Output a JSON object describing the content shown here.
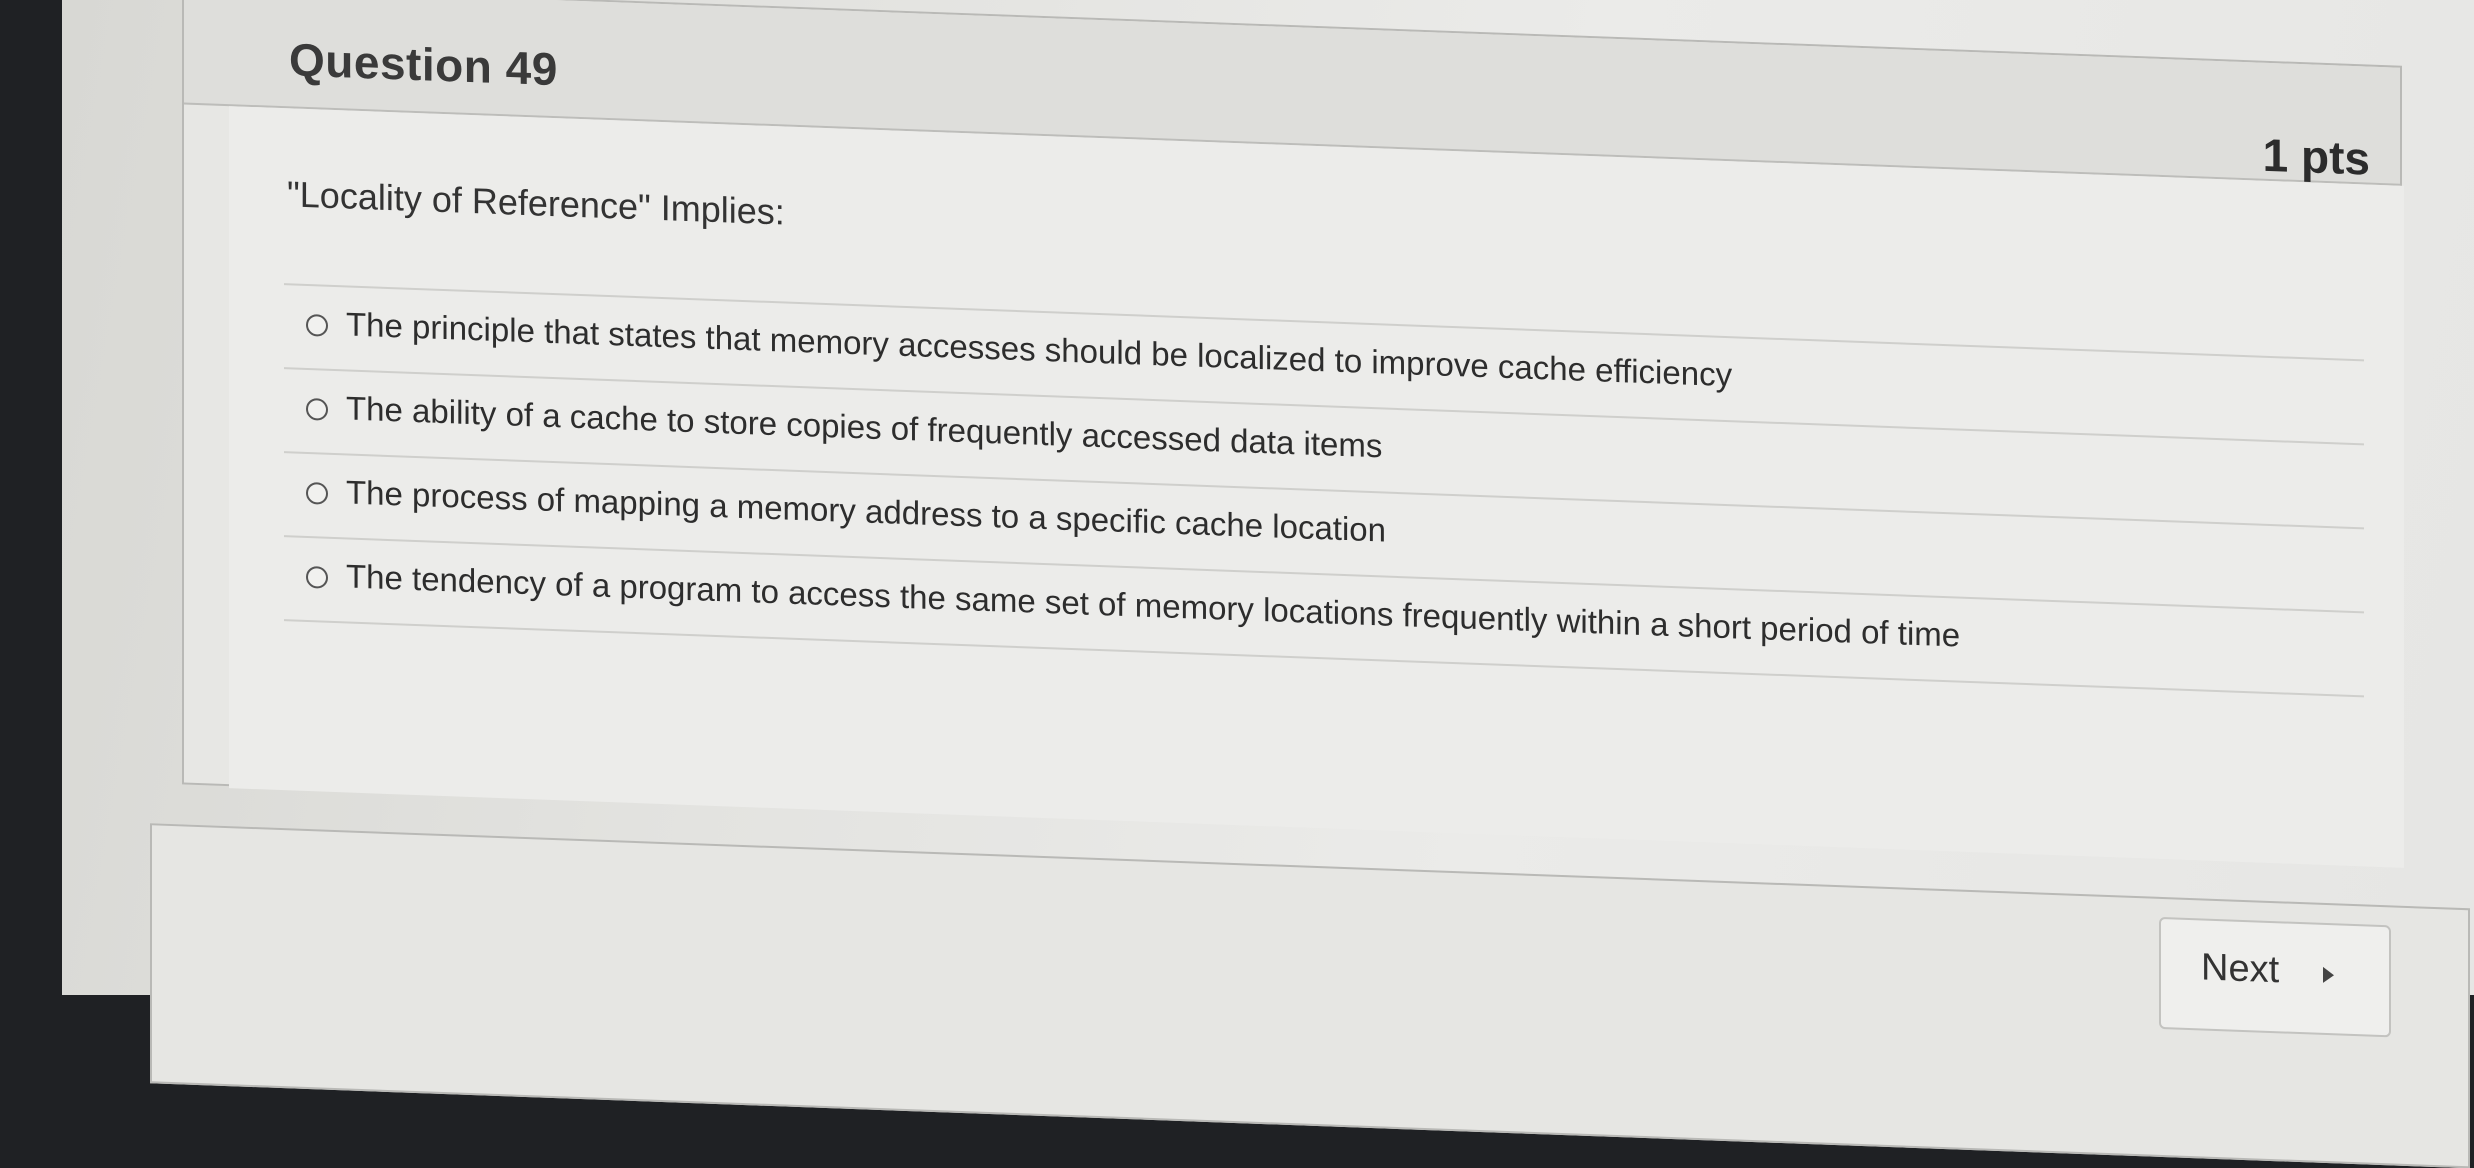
{
  "question": {
    "title": "Question 49",
    "points": "1 pts",
    "prompt": "\"Locality of Reference\" Implies:",
    "answers": [
      {
        "label": "The principle that states that memory accesses should be localized to improve cache efficiency"
      },
      {
        "label": "The ability of a cache to store copies of frequently accessed data items"
      },
      {
        "label": "The process of mapping a memory address to a specific cache location"
      },
      {
        "label": "The tendency of a program to access the same set of memory locations frequently within a short period of time"
      }
    ]
  },
  "navigation": {
    "next_label": "Next",
    "next_icon": "triangle-right-icon"
  }
}
